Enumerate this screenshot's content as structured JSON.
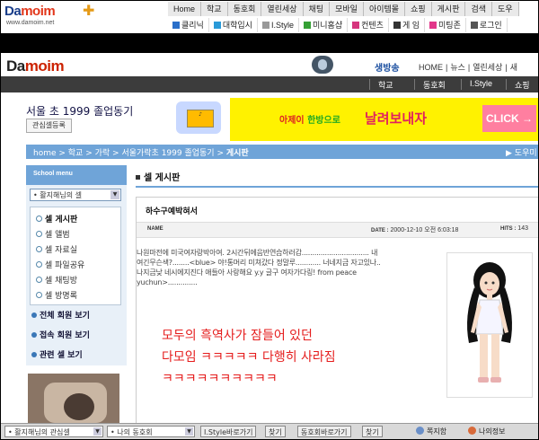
{
  "top_logo": {
    "brand_a": "Da",
    "brand_b": "moim",
    "url": "www.damoim.net"
  },
  "top_menu": [
    "Home",
    "학교",
    "동호회",
    "열린세상",
    "채팅",
    "모바일",
    "아이템몰",
    "쇼핑",
    "게시판",
    "검색",
    "도우"
  ],
  "top_menu2": [
    {
      "label": "클리닉",
      "color": "#2a6fc9"
    },
    {
      "label": "대학입시",
      "color": "#2a9ad8"
    },
    {
      "label": "I.Style",
      "color": "#999999"
    },
    {
      "label": "미니홈샵",
      "color": "#35a035"
    },
    {
      "label": "컨텐츠",
      "color": "#d6357d"
    },
    {
      "label": "게 임",
      "color": "#333333"
    },
    {
      "label": "미팅존",
      "color": "#e2368a"
    },
    {
      "label": "로그인",
      "color": "#555555"
    }
  ],
  "site": {
    "logo_a": "Da",
    "logo_b": "moim",
    "live_label": "생방송",
    "head_nav": [
      "HOME",
      "뉴스",
      "열린세상",
      "새"
    ],
    "main_nav": [
      "학교",
      "동호회",
      "I.Style",
      "쇼핑"
    ]
  },
  "club": {
    "title": "서울      초 1999 졸업동기",
    "register_button": "관심셀등록"
  },
  "banner": {
    "text_a": "아제이",
    "text_b": "한방으로",
    "text_c": "날려보내자",
    "cta": "CLICK →"
  },
  "breadcrumb": {
    "items": [
      "home",
      "학교",
      "가락",
      "서울가락초 1999 졸업동기"
    ],
    "current": "게시판",
    "help": "도우미"
  },
  "left_menu": {
    "header": "School menu",
    "selector": "활지해님의 셀",
    "items": [
      "셀 게시판",
      "셀 앨범",
      "셀 자료실",
      "셀 파일공유",
      "셀 채팅방",
      "셀 방명록"
    ],
    "active_index": 0,
    "links": [
      "전체 회원 보기",
      "접속 회원 보기",
      "관련 셀 보기"
    ]
  },
  "main": {
    "section_title": "셀 게시판",
    "post": {
      "title": "하수구예박혀서",
      "name_label": "NAME",
      "date_label": "DATE :",
      "date_value": "2000-12-10 오전 6:03:18",
      "hits_label": "HITS :",
      "hits_value": "143",
      "body": "나원마전에 미국여자랑박아여. 2시간뒤에음반연습하러감................................ 내\n여긴무슨색?........<blue> 야!통머리 미쳐갔다 정말루............ 너네지금 자고있나..\n나지금낮 네시에지진다 애들아 사랑해요 y.y 글구 여자가다링! from peace\nyuchun>.............."
    }
  },
  "caption": "모두의 흑역사가 잠들어 있던\n다모임 ㅋㅋㅋㅋㅋ 다행히 사라짐\nㅋㅋㅋㅋㅋㅋㅋㅋㅋㅋ",
  "bottom_bar": {
    "select1": "활지해님의 관심셀",
    "select2": "나의 동호회",
    "btn1": "I.Style바로가기",
    "btn_go1": "찾기",
    "btn2": "동호회바로가기",
    "btn_go2": "찾기",
    "right1": "쪽지함",
    "right2": "나의정보"
  }
}
